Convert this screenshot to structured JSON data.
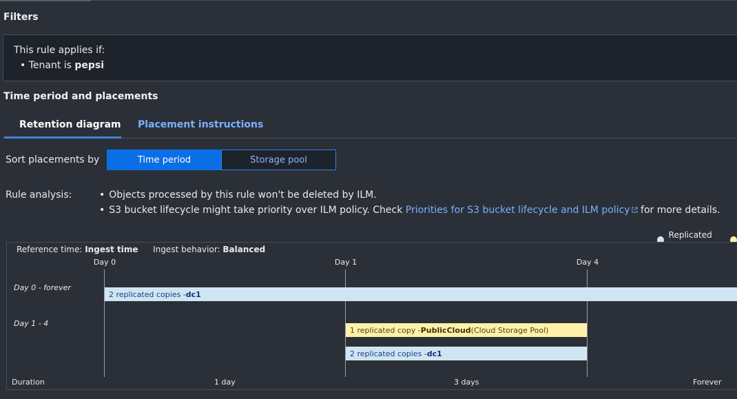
{
  "filters": {
    "title": "Filters",
    "intro": "This rule applies if:",
    "condition_prefix": "Tenant is ",
    "condition_value": "pepsi"
  },
  "time_period": {
    "title": "Time period and placements",
    "tabs": [
      {
        "label": "Retention diagram",
        "active": true
      },
      {
        "label": "Placement instructions",
        "active": false
      }
    ]
  },
  "sort": {
    "label": "Sort placements by",
    "options": [
      "Time period",
      "Storage pool"
    ],
    "selected": "Time period"
  },
  "analysis": {
    "label": "Rule analysis:",
    "items": [
      "Objects processed by this rule won't be deleted by ILM."
    ],
    "s3_item": {
      "prefix": "S3 bucket lifecycle might take priority over ILM policy. Check ",
      "link": "Priorities for S3 bucket lifecycle and ILM policy",
      "suffix": " for more details."
    }
  },
  "legend": {
    "items": [
      "Replicated copy"
    ],
    "colors": {
      "replicated": "#cfe6f2",
      "cloud": "#fff2a8"
    }
  },
  "diagram": {
    "reference_label": "Reference time: ",
    "reference_value": "Ingest time",
    "behavior_label": "Ingest behavior: ",
    "behavior_value": "Balanced",
    "days": [
      "Day 0",
      "Day 1",
      "Day 4"
    ],
    "rows": [
      {
        "label": "Day 0 - forever",
        "bars": [
          {
            "prefix": "2 replicated copies - ",
            "bold": "dc1",
            "suffix": ""
          }
        ]
      },
      {
        "label": "Day 1 - 4",
        "bars": [
          {
            "prefix": "1 replicated copy - ",
            "bold": "PublicCloud",
            "suffix": " (Cloud Storage Pool)"
          },
          {
            "prefix": "2 replicated copies - ",
            "bold": "dc1",
            "suffix": ""
          }
        ]
      }
    ],
    "durations": [
      "Duration",
      "1 day",
      "3 days",
      "Forever"
    ]
  }
}
